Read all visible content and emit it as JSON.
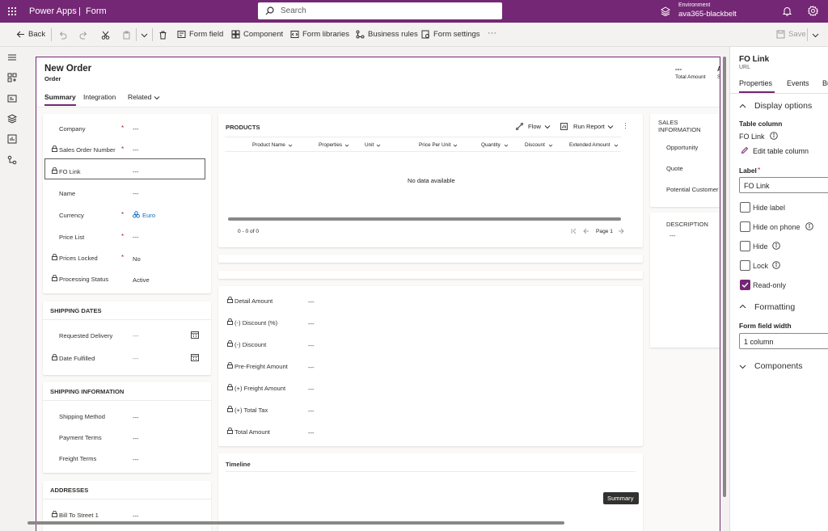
{
  "topbar": {
    "app_name": "Power Apps",
    "separator": "|",
    "section": "Form",
    "search_placeholder": "Search",
    "environment_label": "Environment",
    "environment_name": "ava365-blackbelt"
  },
  "commandbar": {
    "back": "Back",
    "form_field": "Form field",
    "component": "Component",
    "form_libraries": "Form libraries",
    "business_rules": "Business rules",
    "form_settings": "Form settings",
    "more": "···",
    "save": "Save"
  },
  "form": {
    "title": "New Order",
    "subtitle": "Order",
    "total_amount_value": "---",
    "total_amount_label": "Total Amount",
    "header_right_a": "A",
    "header_right_s": "S",
    "tabs": [
      "Summary",
      "Integration",
      "Related"
    ],
    "summary_fields": [
      {
        "label": "Company",
        "value": "---",
        "required": "*",
        "locked": false
      },
      {
        "label": "Sales Order Number",
        "value": "---",
        "required": "*",
        "locked": true
      },
      {
        "label": "FO Link",
        "value": "---",
        "required": "",
        "locked": true
      },
      {
        "label": "Name",
        "value": "---",
        "required": "",
        "locked": false
      },
      {
        "label": "Currency",
        "value": "Euro",
        "required": "*",
        "locked": false
      },
      {
        "label": "Price List",
        "value": "---",
        "required": "*",
        "locked": false
      },
      {
        "label": "Prices Locked",
        "value": "No",
        "required": "*",
        "locked": true
      },
      {
        "label": "Processing Status",
        "value": "Active",
        "required": "",
        "locked": true
      }
    ],
    "shipping_dates": {
      "title": "SHIPPING DATES",
      "fields": [
        {
          "label": "Requested Delivery",
          "value": "---"
        },
        {
          "label": "Date Fulfilled",
          "value": "---"
        }
      ]
    },
    "shipping_info": {
      "title": "SHIPPING INFORMATION",
      "fields": [
        {
          "label": "Shipping Method",
          "value": "---"
        },
        {
          "label": "Payment Terms",
          "value": "---"
        },
        {
          "label": "Freight Terms",
          "value": "---"
        }
      ]
    },
    "addresses": {
      "title": "ADDRESSES",
      "fields": [
        {
          "label": "Bill To Street 1",
          "value": "---"
        }
      ]
    },
    "products": {
      "title": "PRODUCTS",
      "flow": "Flow",
      "run_report": "Run Report",
      "columns": [
        "Product Name",
        "Properties",
        "Unit",
        "Price Per Unit",
        "Quantity",
        "Discount",
        "Extended Amount"
      ],
      "empty": "No data available",
      "count": "0 - 0 of 0",
      "page": "Page 1"
    },
    "amounts": [
      {
        "label": "Detail Amount",
        "value": "---"
      },
      {
        "label": "(-) Discount (%)",
        "value": "---"
      },
      {
        "label": "(-) Discount",
        "value": "---"
      },
      {
        "label": "Pre-Freight Amount",
        "value": "---"
      },
      {
        "label": "(+) Freight Amount",
        "value": "---"
      },
      {
        "label": "(+) Total Tax",
        "value": "---"
      },
      {
        "label": "Total Amount",
        "value": "---"
      }
    ],
    "timeline": "Timeline",
    "tooltip": "Summary",
    "sales_info": {
      "title": "SALES INFORMATION",
      "fields": [
        "Opportunity",
        "Quote",
        "Potential Customer"
      ]
    },
    "description": {
      "title": "DESCRIPTION",
      "value": "---"
    }
  },
  "panel": {
    "title": "FO Link",
    "subtitle": "URL",
    "tabs": [
      "Properties",
      "Events",
      "Bu"
    ],
    "display_options": "Display options",
    "table_column_label": "Table column",
    "table_column_value": "FO Link",
    "edit_table_column": "Edit table column",
    "label_title": "Label",
    "label_required": "*",
    "label_value": "FO Link",
    "checkboxes": [
      {
        "label": "Hide label",
        "checked": false
      },
      {
        "label": "Hide on phone",
        "checked": false
      },
      {
        "label": "Hide",
        "checked": false
      },
      {
        "label": "Lock",
        "checked": false
      },
      {
        "label": "Read-only",
        "checked": true
      }
    ],
    "formatting": "Formatting",
    "form_field_width_label": "Form field width",
    "form_field_width_value": "1 column",
    "components": "Components"
  },
  "colors": {
    "brand": "#742774",
    "link": "#0f6cbd",
    "required": "#a4262c"
  }
}
